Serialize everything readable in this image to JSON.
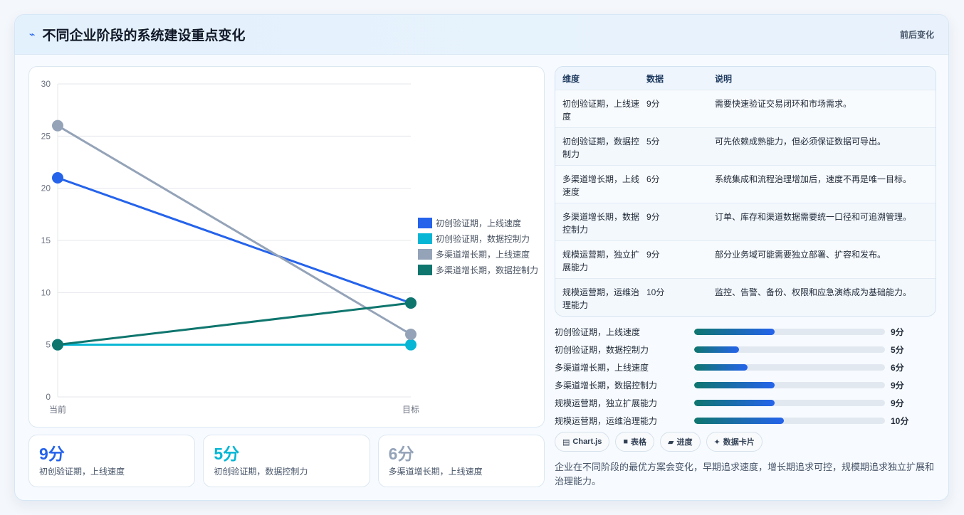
{
  "header": {
    "title": "不同企业阶段的系统建设重点变化",
    "tag": "前后变化"
  },
  "chart_data": {
    "type": "line",
    "x": [
      "当前",
      "目标"
    ],
    "ylim": [
      0,
      30
    ],
    "yticks": [
      0,
      5,
      10,
      15,
      20,
      25,
      30
    ],
    "series": [
      {
        "name": "初创验证期，上线速度",
        "values": [
          21,
          9
        ],
        "color": "#2563eb"
      },
      {
        "name": "初创验证期，数据控制力",
        "values": [
          5,
          5
        ],
        "color": "#06b6d4"
      },
      {
        "name": "多渠道增长期，上线速度",
        "values": [
          26,
          6
        ],
        "color": "#94a3b8"
      },
      {
        "name": "多渠道增长期，数据控制力",
        "values": [
          5,
          9
        ],
        "color": "#0f766e"
      }
    ],
    "legend_position": "right"
  },
  "kpis": [
    {
      "value": "9分",
      "label": "初创验证期，上线速度",
      "color": "#2563eb"
    },
    {
      "value": "5分",
      "label": "初创验证期，数据控制力",
      "color": "#06b6d4"
    },
    {
      "value": "6分",
      "label": "多渠道增长期，上线速度",
      "color": "#94a3b8"
    }
  ],
  "table": {
    "headers": [
      "维度",
      "数据",
      "说明"
    ],
    "rows": [
      [
        "初创验证期，上线速度",
        "9分",
        "需要快速验证交易闭环和市场需求。"
      ],
      [
        "初创验证期，数据控制力",
        "5分",
        "可先依赖成熟能力，但必须保证数据可导出。"
      ],
      [
        "多渠道增长期，上线速度",
        "6分",
        "系统集成和流程治理增加后，速度不再是唯一目标。"
      ],
      [
        "多渠道增长期，数据控制力",
        "9分",
        "订单、库存和渠道数据需要统一口径和可追溯管理。"
      ],
      [
        "规模运营期，独立扩展能力",
        "9分",
        "部分业务域可能需要独立部署、扩容和发布。"
      ],
      [
        "规模运营期，运维治理能力",
        "10分",
        "监控、告警、备份、权限和应急演练成为基础能力。"
      ]
    ]
  },
  "progress": [
    {
      "label": "初创验证期，上线速度",
      "value": "9分",
      "fraction": 0.42
    },
    {
      "label": "初创验证期，数据控制力",
      "value": "5分",
      "fraction": 0.235
    },
    {
      "label": "多渠道增长期，上线速度",
      "value": "6分",
      "fraction": 0.28
    },
    {
      "label": "多渠道增长期，数据控制力",
      "value": "9分",
      "fraction": 0.42
    },
    {
      "label": "规模运营期，独立扩展能力",
      "value": "9分",
      "fraction": 0.42
    },
    {
      "label": "规模运营期，运维治理能力",
      "value": "10分",
      "fraction": 0.47
    }
  ],
  "chips": [
    {
      "icon": "▤",
      "label": "Chart.js"
    },
    {
      "icon": "■",
      "label": "表格"
    },
    {
      "icon": "▰",
      "label": "进度"
    },
    {
      "icon": "✦",
      "label": "数据卡片"
    }
  ],
  "note": "企业在不同阶段的最优方案会变化，早期追求速度，增长期追求可控，规模期追求独立扩展和治理能力。"
}
